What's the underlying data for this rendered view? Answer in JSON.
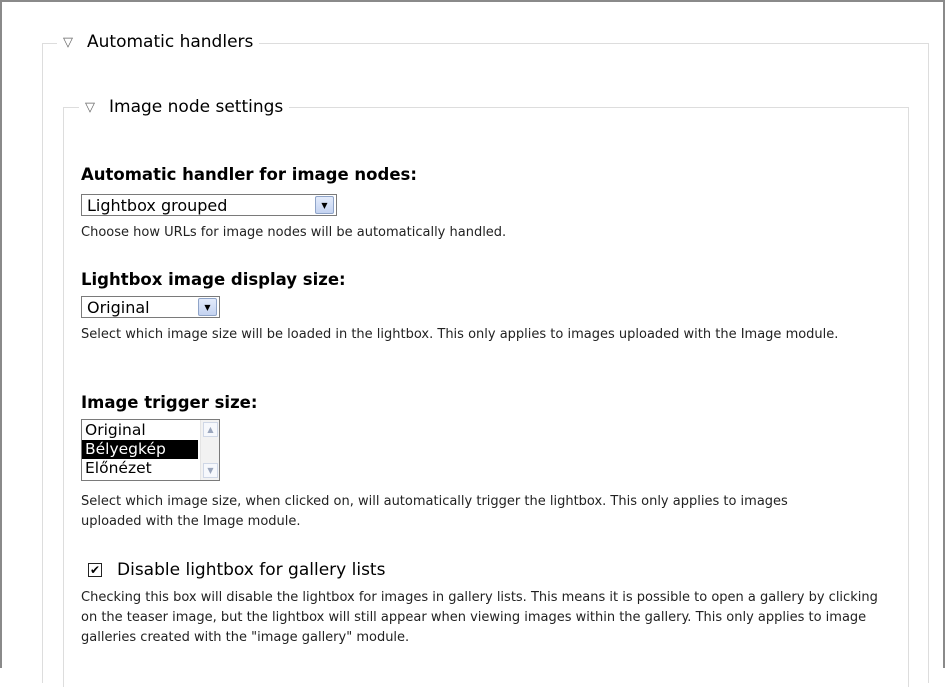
{
  "fieldsets": {
    "automatic_handlers": {
      "toggle_icon": "collapse-triangle-icon",
      "legend": "Automatic handlers"
    },
    "image_node_settings": {
      "toggle_icon": "collapse-triangle-icon",
      "legend": "Image node settings"
    }
  },
  "handler": {
    "label": "Automatic handler for image nodes:",
    "selected": "Lightbox grouped",
    "description": "Choose how URLs for image nodes will be automatically handled."
  },
  "display_size": {
    "label": "Lightbox image display size:",
    "selected": "Original",
    "description": "Select which image size will be loaded in the lightbox. This only applies to images uploaded with the Image module."
  },
  "trigger_size": {
    "label": "Image trigger size:",
    "options": [
      "Original",
      "Bélyegkép",
      "Előnézet"
    ],
    "selected": "Bélyegkép",
    "description": "Select which image size, when clicked on, will automatically trigger the lightbox. This only applies to images uploaded with the Image module."
  },
  "gallery": {
    "checked": true,
    "label": "Disable lightbox for gallery lists",
    "description": "Checking this box will disable the lightbox for images in gallery lists. This means it is possible to open a gallery by clicking on the teaser image, but the lightbox will still appear when viewing images within the gallery. This only applies to image galleries created with the \"image gallery\" module."
  },
  "icons": {
    "select_arrow": "chevron-down-icon",
    "scroll_up": "scroll-up-icon",
    "scroll_down": "scroll-down-icon",
    "check": "checkmark-icon"
  }
}
